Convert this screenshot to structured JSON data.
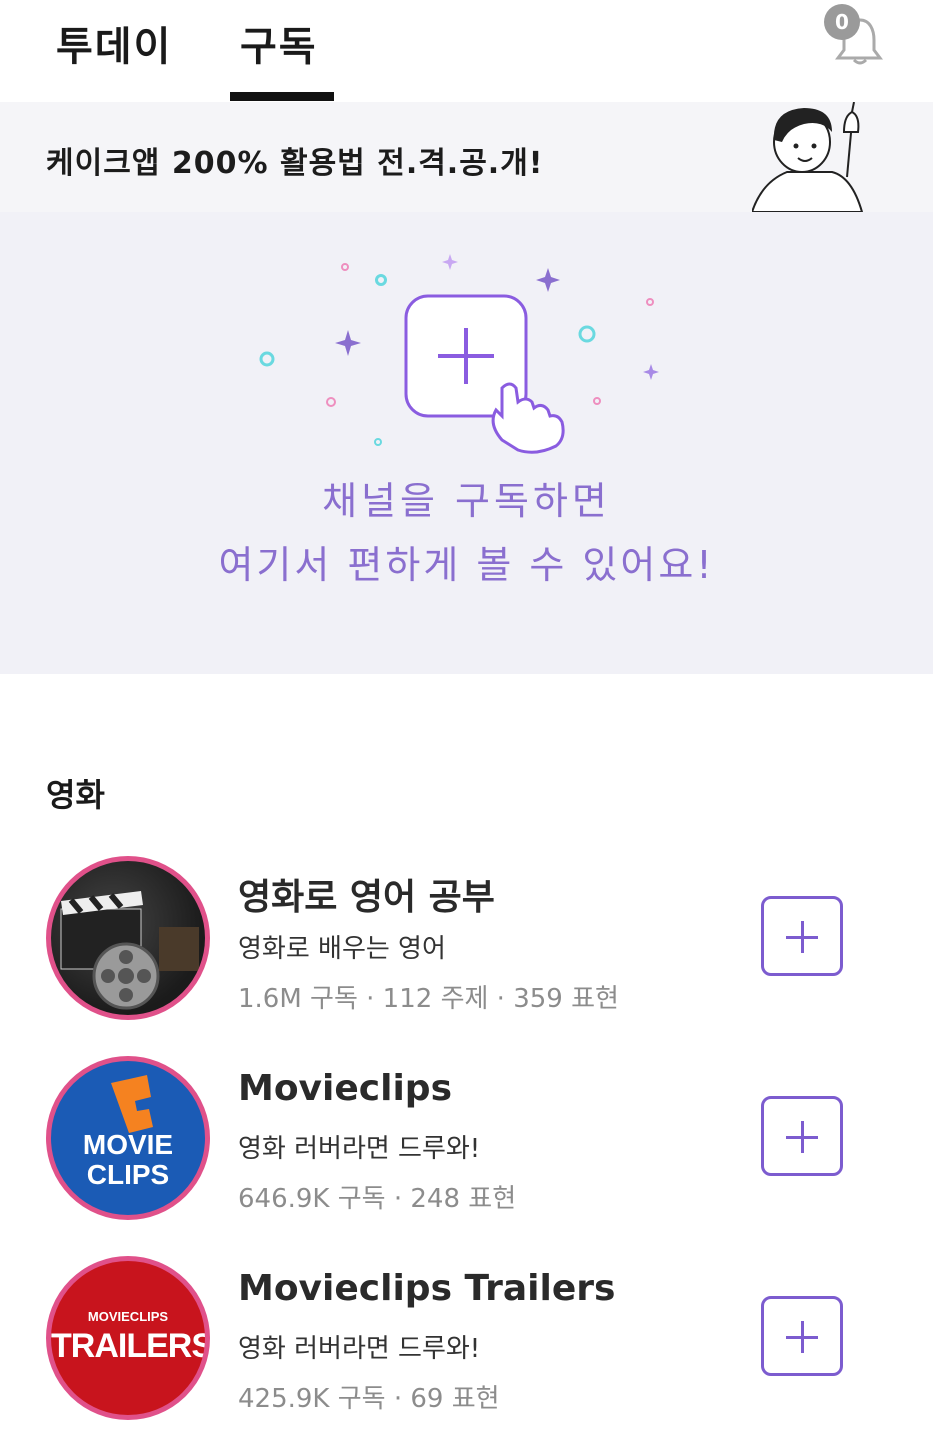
{
  "tabs": [
    {
      "label": "투데이",
      "active": false
    },
    {
      "label": "구독",
      "active": true
    }
  ],
  "notifications": {
    "count": "0"
  },
  "banner": {
    "text": "케이크앱 200% 활용법 전.격.공.개!"
  },
  "empty_state": {
    "line1": "채널을 구독하면",
    "line2": "여기서 편하게 볼 수 있어요!"
  },
  "category": {
    "title": "영화"
  },
  "channels": [
    {
      "name": "영화로 영어 공부",
      "description": "영화로 배우는 영어",
      "stats": "1.6M 구독 · 112 주제 · 359 표현"
    },
    {
      "name": "Movieclips",
      "description": "영화 러버라면 드루와!",
      "stats": "646.9K 구독 · 248 표현",
      "logo_text": [
        "MOVIE",
        "CLIPS"
      ]
    },
    {
      "name": "Movieclips Trailers",
      "description": "영화 러버라면 드루와!",
      "stats": "425.9K 구독 · 69 표현",
      "logo_text": [
        "MOVIECLIPS",
        "TRAILERS"
      ]
    }
  ],
  "colors": {
    "accent": "#7c5ccf",
    "empty_text": "#8a6fcf",
    "avatar_ring": "#e0518a"
  }
}
